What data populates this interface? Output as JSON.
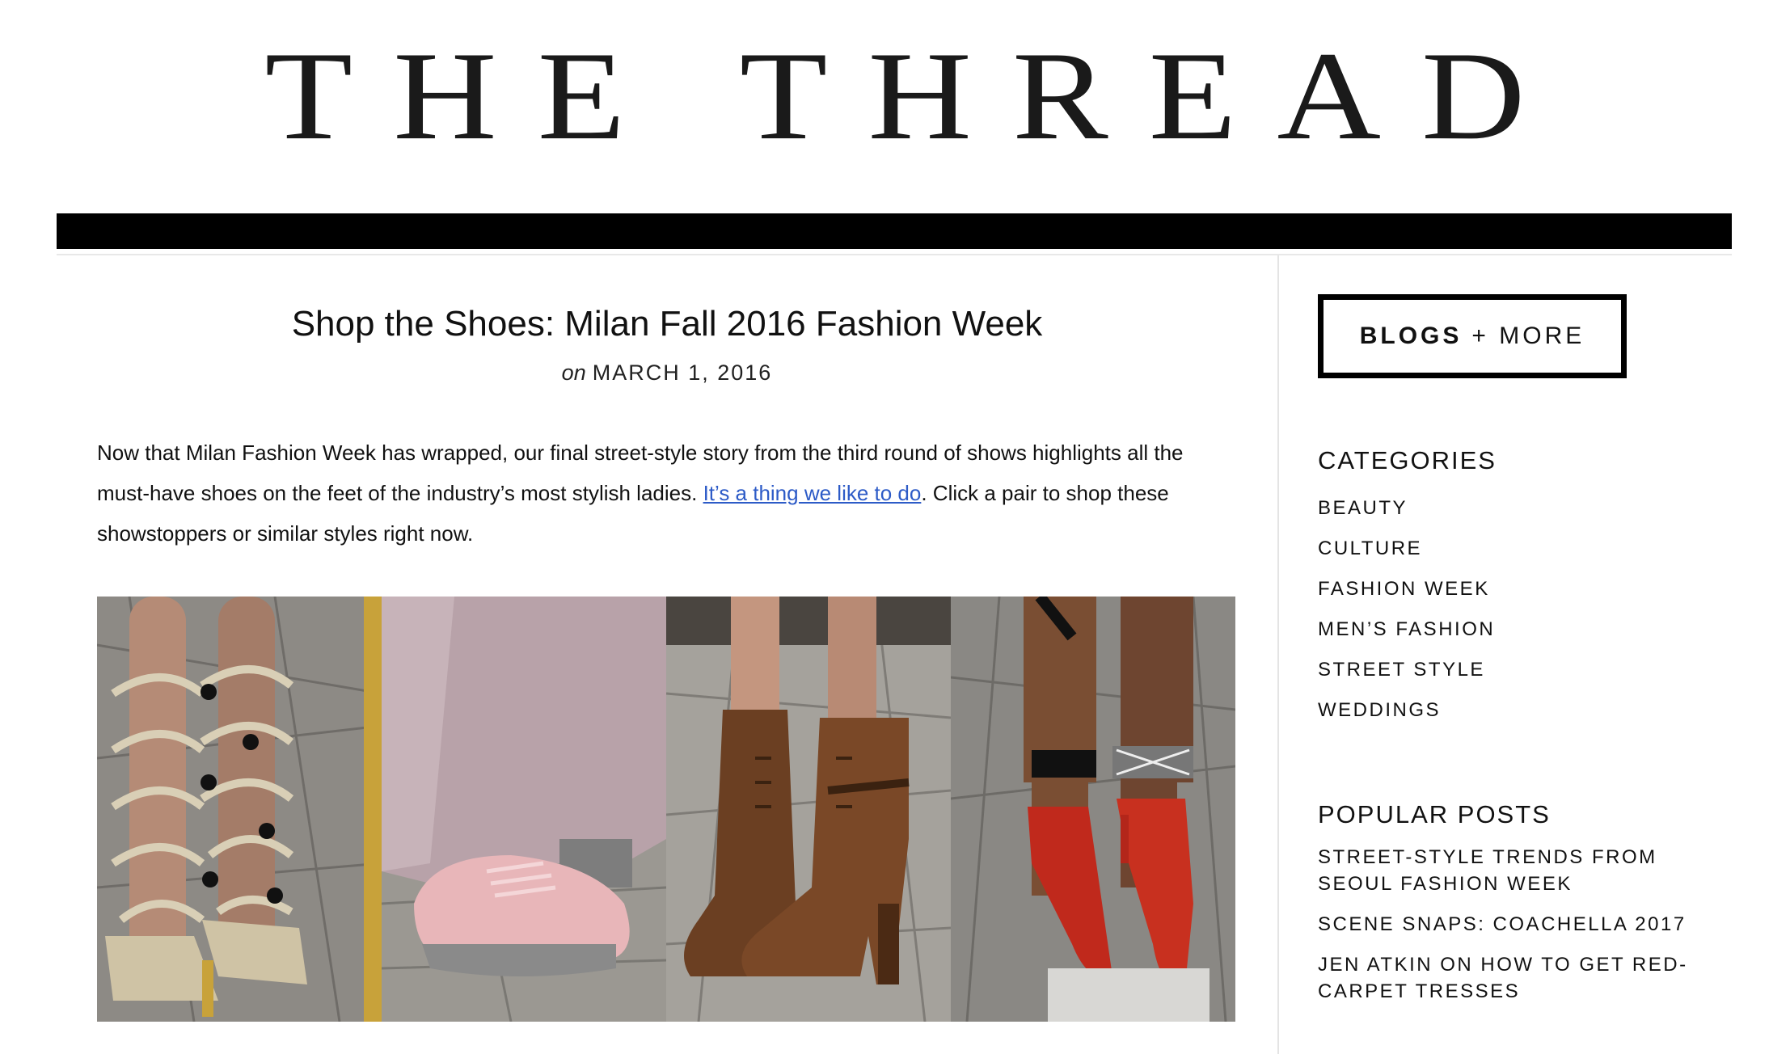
{
  "site": {
    "title": "THE THREAD"
  },
  "post": {
    "title": "Shop the Shoes: Milan Fall 2016 Fashion Week",
    "date_prefix": "on",
    "date": "MARCH 1, 2016",
    "intro_part1": "Now that Milan Fashion Week has wrapped, our final street-style story from the third round of shows highlights all the must-have shoes on the feet of the industry’s most stylish ladies. ",
    "intro_link": "It’s a thing we like to do",
    "intro_part2": ". Click a pair to shop these showstoppers or similar styles right now."
  },
  "sidebar": {
    "blogs_bold": "BLOGS",
    "blogs_rest": "+ MORE",
    "categories_heading": "CATEGORIES",
    "categories": [
      "BEAUTY",
      "CULTURE",
      "FASHION WEEK",
      "MEN’S FASHION",
      "STREET STYLE",
      "WEDDINGS"
    ],
    "popular_heading": "POPULAR POSTS",
    "popular": [
      "STREET-STYLE TRENDS FROM SEOUL FASHION WEEK",
      "SCENE SNAPS: COACHELLA 2017",
      "JEN ATKIN ON HOW TO GET RED-CARPET TRESSES"
    ]
  },
  "gallery": {
    "shoes": [
      "gold-lace-up-heels",
      "pink-sneakers",
      "brown-leather-boots",
      "red-pumps"
    ]
  }
}
